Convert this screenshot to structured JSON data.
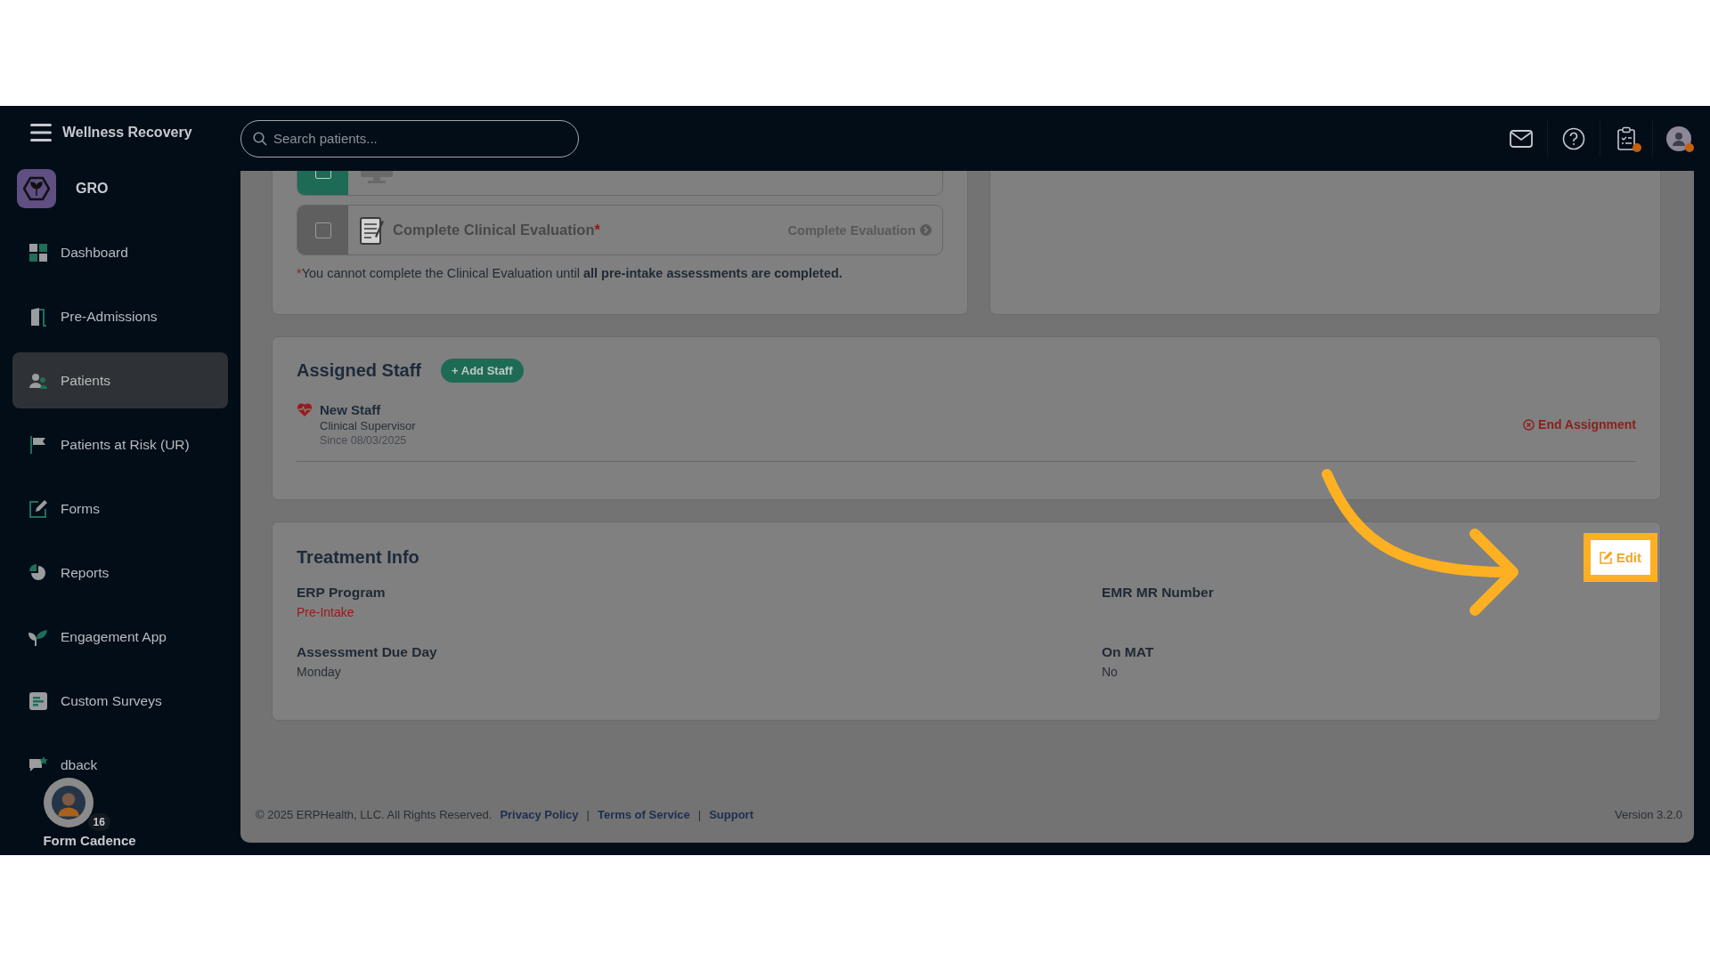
{
  "header": {
    "brand": "Wellness Recovery",
    "search": {
      "placeholder": "Search patients..."
    },
    "icons": [
      {
        "kind": "mail",
        "dot": false
      },
      {
        "kind": "help",
        "dot": false
      },
      {
        "kind": "clipboard",
        "dot": true
      },
      {
        "kind": "account",
        "dot": true
      }
    ]
  },
  "sidebar": {
    "org": "GRO",
    "items": [
      {
        "label": "Dashboard",
        "selected": false
      },
      {
        "label": "Pre-Admissions",
        "selected": false
      },
      {
        "label": "Patients",
        "selected": true
      },
      {
        "label": "Patients at Risk (UR)",
        "selected": false
      },
      {
        "label": "Forms",
        "selected": false
      },
      {
        "label": "Reports",
        "selected": false
      },
      {
        "label": "Engagement App",
        "selected": false
      },
      {
        "label": "Custom Surveys",
        "selected": false
      },
      {
        "label": "dback",
        "selected": false
      }
    ],
    "form_cadence": {
      "count": "16",
      "label": "Form Cadence"
    }
  },
  "tasks": {
    "items": [
      {
        "checked": true
      },
      {
        "checked": false,
        "label": "Complete Clinical Evaluation",
        "mark": "*",
        "action": "Complete Evaluation"
      }
    ],
    "note_mark": "*",
    "note": "You cannot complete the Clinical Evaluation until **all pre-intake assessments are completed.**"
  },
  "assigned_staff": {
    "title": "Assigned Staff",
    "add_button": "+ Add Staff",
    "staff": [
      {
        "name": "New Staff",
        "role": "Clinical Supervisor",
        "since": "Since 08/03/2025",
        "action": "End Assignment"
      }
    ]
  },
  "treatment_info": {
    "title": "Treatment Info",
    "edit_button": "Edit",
    "fields": [
      {
        "label": "ERP Program",
        "value": "Pre-Intake",
        "kind": "alert"
      },
      {
        "label": "EMR MR Number",
        "kind": "plain"
      },
      {
        "label": "Assessment Due Day",
        "value": "Monday",
        "kind": "plain"
      },
      {
        "label": "On MAT",
        "value": "No",
        "kind": "plain"
      }
    ]
  },
  "footer": {
    "copyright": "© 2025 ERPHealth, LLC. All Rights Reserved.",
    "links": [
      "Privacy Policy",
      "Terms of Service",
      "Support"
    ],
    "separator": "|",
    "version": "Version 3.2.0"
  }
}
